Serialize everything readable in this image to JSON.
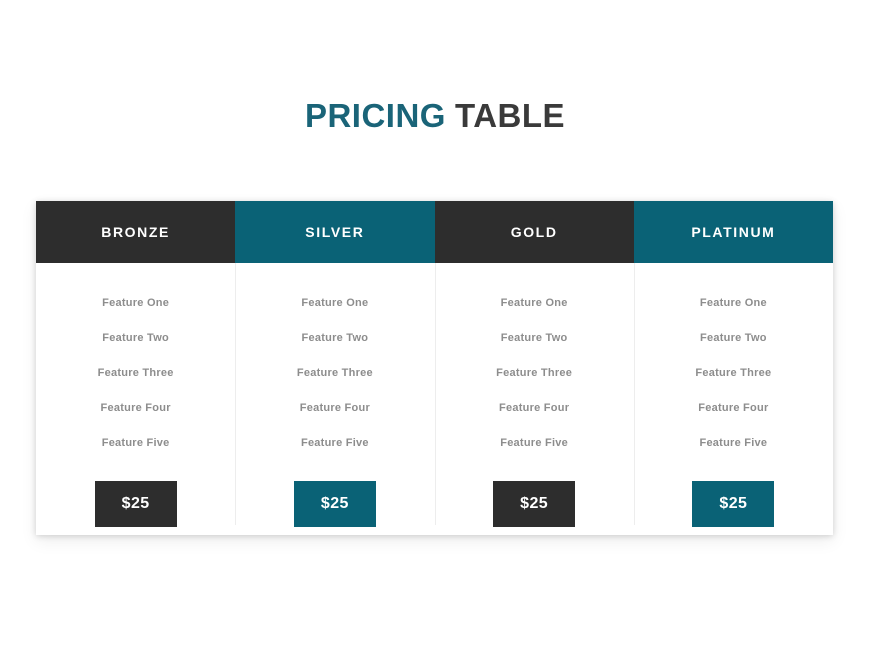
{
  "page": {
    "background_color": "#ffffff"
  },
  "title": {
    "accent_text": "PRICING",
    "plain_text": "TABLE",
    "accent_color": "#1a6478",
    "plain_color": "#3a3a3a"
  },
  "colors": {
    "dark": "#2d2d2d",
    "teal": "#0a6276",
    "feature_text": "#8d8d8d",
    "divider": "#ededed"
  },
  "table": {
    "columns": [
      {
        "name": "BRONZE",
        "header_color": "#2d2d2d",
        "button_color": "#2d2d2d",
        "price": "$25",
        "features": [
          "Feature One",
          "Feature Two",
          "Feature Three",
          "Feature Four",
          "Feature Five"
        ]
      },
      {
        "name": "SILVER",
        "header_color": "#0a6276",
        "button_color": "#0a6276",
        "price": "$25",
        "features": [
          "Feature One",
          "Feature Two",
          "Feature Three",
          "Feature Four",
          "Feature Five"
        ]
      },
      {
        "name": "GOLD",
        "header_color": "#2d2d2d",
        "button_color": "#2d2d2d",
        "price": "$25",
        "features": [
          "Feature One",
          "Feature Two",
          "Feature Three",
          "Feature Four",
          "Feature Five"
        ]
      },
      {
        "name": "PLATINUM",
        "header_color": "#0a6276",
        "button_color": "#0a6276",
        "price": "$25",
        "features": [
          "Feature One",
          "Feature Two",
          "Feature Three",
          "Feature Four",
          "Feature Five"
        ]
      }
    ]
  }
}
